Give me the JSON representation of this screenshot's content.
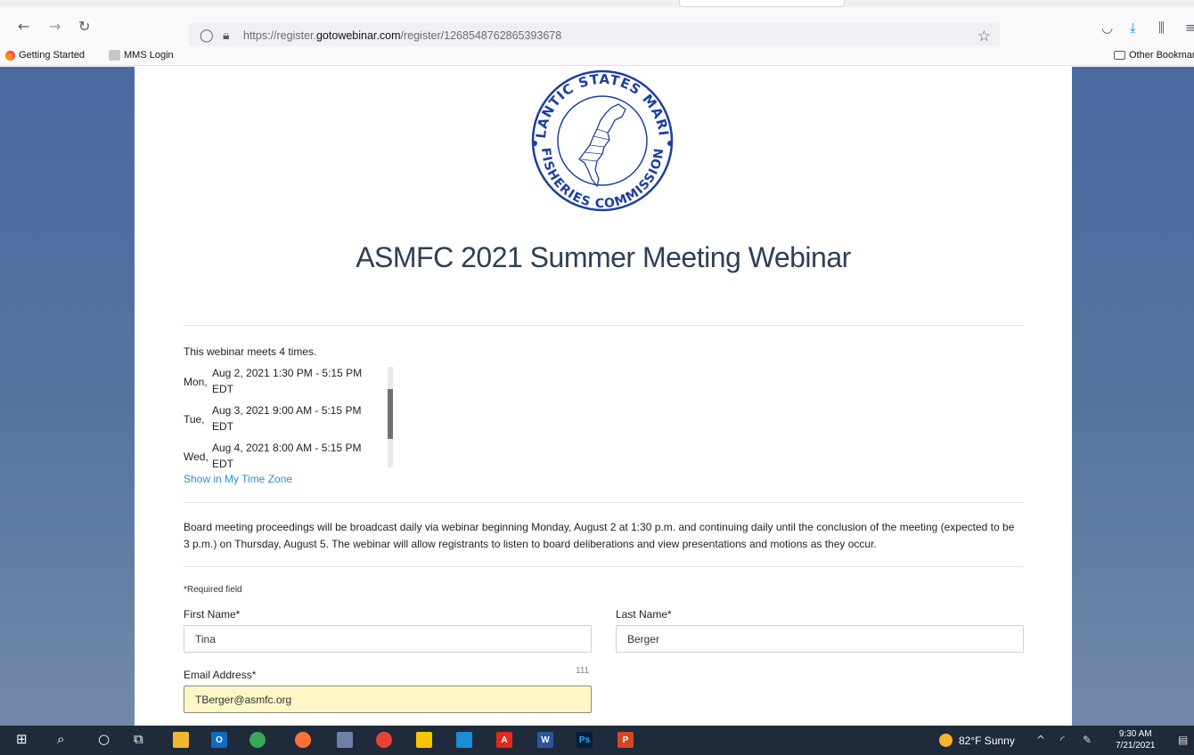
{
  "browser": {
    "url_prefix": "https://register.",
    "url_domain": "gotowebinar.com",
    "url_path": "/register/1268548762865393678",
    "bookmarks": [
      "Getting Started",
      "MMS Login"
    ],
    "other_bookmarks": "Other Bookmar"
  },
  "logo": {
    "top_text": "ATLANTIC STATES MARINE",
    "bottom_text": "FISHERIES COMMISSION"
  },
  "page": {
    "title": "ASMFC 2021 Summer Meeting Webinar",
    "meets_text": "This webinar meets 4 times.",
    "sessions": [
      {
        "day": "Mon,",
        "line1": "Aug 2, 2021 1:30 PM - 5:15 PM",
        "line2": "EDT"
      },
      {
        "day": "Tue,",
        "line1": "Aug 3, 2021 9:00 AM - 5:15 PM",
        "line2": "EDT"
      },
      {
        "day": "Wed,",
        "line1": "Aug 4, 2021 8:00 AM - 5:15 PM",
        "line2": "EDT"
      }
    ],
    "timezone_link": "Show in My Time Zone",
    "description": "Board meeting proceedings will be broadcast daily via webinar beginning Monday, August 2 at  1:30 p.m. and continuing daily until the conclusion of the meeting (expected to be 3 p.m.) on Thursday, August 5. The webinar will allow registrants to listen to board deliberations and view presentations and motions as they occur.",
    "required_note": "*Required field"
  },
  "form": {
    "first_name_label": "First Name*",
    "first_name_value": "Tina",
    "last_name_label": "Last Name*",
    "last_name_value": "Berger",
    "email_label": "Email Address*",
    "email_counter": "111",
    "email_value": "TBerger@asmfc.org"
  },
  "taskbar": {
    "weather": "82°F  Sunny",
    "time": "9:30 AM",
    "date": "7/21/2021"
  },
  "colors": {
    "page_background": "#4a6aa0",
    "title": "#2e3f55",
    "link": "#2a8fd0",
    "email_highlight": "#fcf7c5",
    "logo_blue": "#1c3f9e"
  }
}
